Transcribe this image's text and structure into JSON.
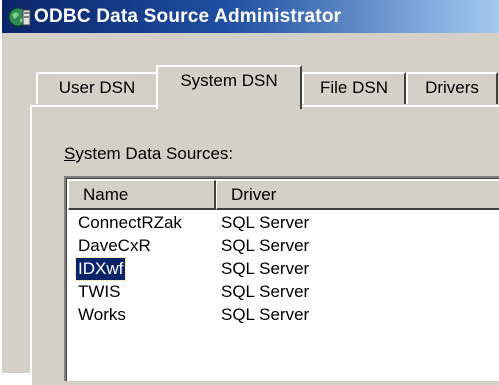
{
  "window": {
    "title": "ODBC Data Source Administrator"
  },
  "tabs": [
    {
      "label": "User DSN",
      "active": false
    },
    {
      "label": "System DSN",
      "active": true
    },
    {
      "label": "File DSN",
      "active": false
    },
    {
      "label": "Drivers",
      "active": false
    }
  ],
  "group": {
    "label_prefix": "S",
    "label_rest": "ystem Data Sources:"
  },
  "list": {
    "columns": [
      "Name",
      "Driver"
    ],
    "rows": [
      {
        "name": "ConnectRZak",
        "driver": "SQL Server",
        "selected": false
      },
      {
        "name": "DaveCxR",
        "driver": "SQL Server",
        "selected": false
      },
      {
        "name": "IDXwf",
        "driver": "SQL Server",
        "selected": true
      },
      {
        "name": "TWIS",
        "driver": "SQL Server",
        "selected": false
      },
      {
        "name": "Works",
        "driver": "SQL Server",
        "selected": false
      }
    ]
  },
  "colors": {
    "titlebar_start": "#0a246a",
    "selection": "#0a246a",
    "dialog_face": "#d4d0c8"
  },
  "icons": {
    "title_icon": "odbc-globe-icon"
  }
}
